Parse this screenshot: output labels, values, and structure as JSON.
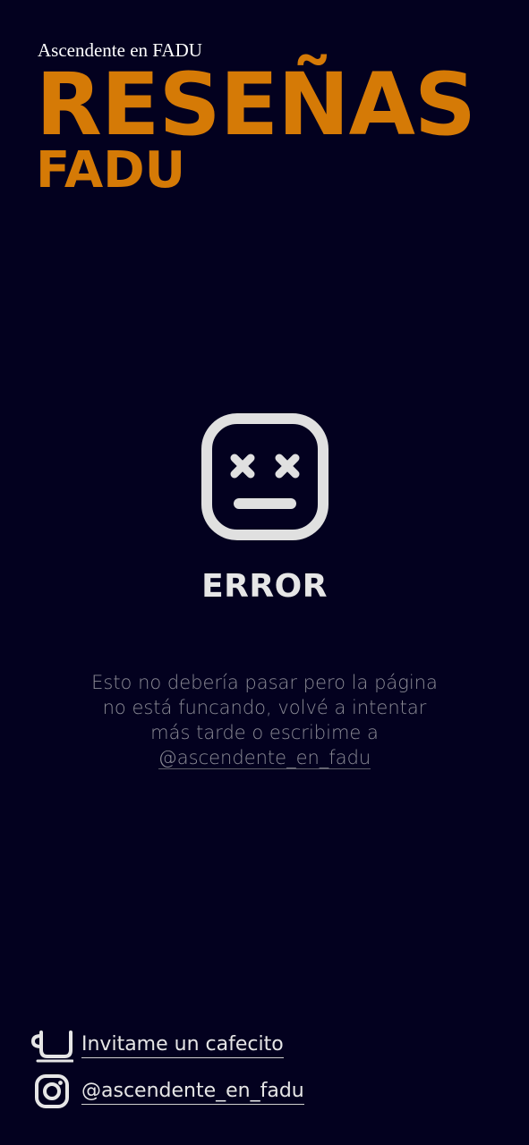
{
  "header": {
    "subtitle": "Ascendente en FADU",
    "title": "RESEÑAS",
    "title_line2": "FADU"
  },
  "error": {
    "icon": "dead-face-icon",
    "title": "ERROR",
    "message_text": "Esto no debería pasar pero la página no está funcando, volvé a intentar más tarde o escribime a",
    "message_link": "@ascendente_en_fadu"
  },
  "footer": {
    "items": [
      {
        "icon": "coffee-cup-icon",
        "label": "Invitame un cafecito"
      },
      {
        "icon": "instagram-icon",
        "label": "@ascendente_en_fadu"
      }
    ]
  },
  "colors": {
    "background": "#03011f",
    "accent": "#d57a06",
    "text": "#e6e6e6",
    "muted": "#8b8b95"
  }
}
